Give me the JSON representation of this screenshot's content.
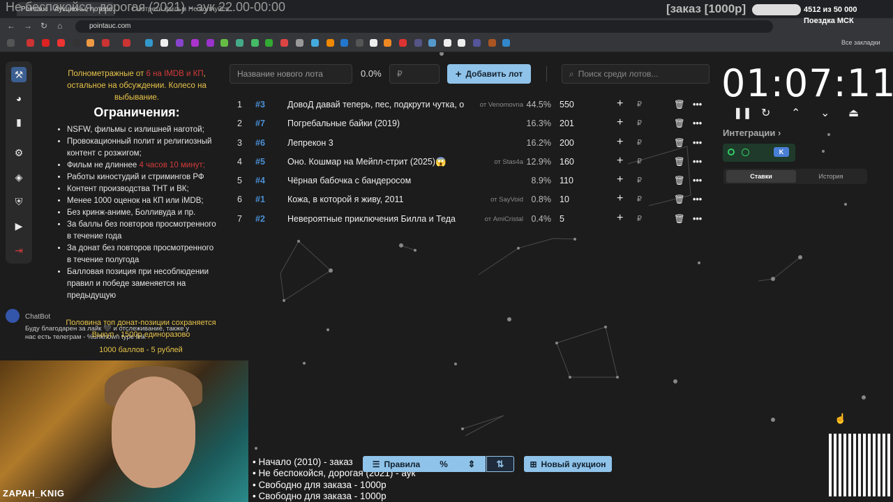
{
  "browser": {
    "tabs": [
      {
        "label": "Pointauc - Аукционы, лотере..."
      },
      {
        "label": "Смотреть фильм Не волнуйся..."
      }
    ],
    "url": "pointauc.com",
    "bookmarks_all": "Все закладки"
  },
  "stream_overlay": {
    "title": "Не беспокойся, дорогая (2021) - аук 22.00-00:00",
    "order": "[заказ [1000р]",
    "count": "4512 из 50 000",
    "trip": "Поездка МСК",
    "ticker": [
      "• Начало (2010) - заказ",
      "• Не беспокойся, дорогая (2021) - аук",
      "• Свободно для заказа - 1000р",
      "• Свободно для заказа - 1000р"
    ],
    "streamer": "ZAPAH_KNIG"
  },
  "rules_panel": {
    "intro_prefix": "Полнометражные от ",
    "intro_highlight": "6 на IMDB и КП",
    "intro_suffix": ", остальное на обсуждении. Колесо на выбывание.",
    "heading": "Ограничения:",
    "items": [
      "NSFW, фильмы с излишней наготой;",
      "Провокационный полит и религиозный контент с розжигом;",
      "Фильм не длиннее",
      "Работы киностудий и стримингов РФ",
      "Контент производства ТНТ и ВК;",
      "Менее 1000 оценок на КП или iMDB;",
      "Без кринж-аниме, Болливуда и пр.",
      "За баллы без повторов просмотренного в течение года",
      "За донат без повторов просмотренного в течение полугода",
      "Балловая позиция при несоблюдении правил и победе заменяется на предыдущую"
    ],
    "length_limit": "4 часов 10 минут;",
    "half_note": "Половина топ донат-позиции сохраняется",
    "buyout": "Выкуп - 1500р единоразово",
    "points_rate": "1000 баллов - 5 рублей"
  },
  "chatbot": {
    "name": "ChatBot",
    "message": "Буду благодарен за лайк 🖤 и отслеживание, также у нас есть телеграм - %unknown type link"
  },
  "controls": {
    "lot_placeholder": "Название нового лота",
    "percent": "0.0%",
    "rub_placeholder": "₽",
    "add_label": "Добавить лот",
    "search_placeholder": "Поиск среди лотов..."
  },
  "lots": [
    {
      "num": "1",
      "id": "#3",
      "name": "ДовоД давай теперь, пес, подкрути чутка, о",
      "from": "от Venomovna",
      "pct": "44.5%",
      "amount": "550"
    },
    {
      "num": "2",
      "id": "#7",
      "name": "Погребальные байки (2019)",
      "from": "",
      "pct": "16.3%",
      "amount": "201"
    },
    {
      "num": "3",
      "id": "#6",
      "name": "Лепрекон 3",
      "from": "",
      "pct": "16.2%",
      "amount": "200"
    },
    {
      "num": "4",
      "id": "#5",
      "name": "Оно. Кошмар на Мейпл-стрит (2025)😱",
      "from": "от Stas4a",
      "pct": "12.9%",
      "amount": "160"
    },
    {
      "num": "5",
      "id": "#4",
      "name": "Чёрная бабочка с бандеросом",
      "from": "",
      "pct": "8.9%",
      "amount": "110"
    },
    {
      "num": "6",
      "id": "#1",
      "name": "Кожа, в которой я живу, 2011",
      "from": "от SayVoid",
      "pct": "0.8%",
      "amount": "10"
    },
    {
      "num": "7",
      "id": "#2",
      "name": "Невероятные приключения Билла и Теда",
      "from": "от AmiCristal",
      "pct": "0.4%",
      "amount": "5"
    }
  ],
  "lot_actions": {
    "plus": "+",
    "rub": "₽",
    "delete": "🗑",
    "more": "•••"
  },
  "timer": {
    "value": "01:07:11"
  },
  "integrations": {
    "label": "Интеграции",
    "chevron": "›"
  },
  "bets_tabs": {
    "bets": "Ставки",
    "history": "История"
  },
  "bottom": {
    "rules_label": "Правила",
    "percent_label": "%",
    "new_auction_label": "Новый аукцион"
  },
  "colors": {
    "accent": "#8fc3ea",
    "lot_id": "#4a90d6",
    "warning": "#e8c44a",
    "danger": "#d43b3b"
  }
}
